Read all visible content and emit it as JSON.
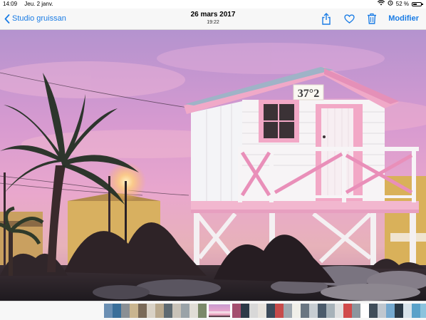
{
  "status_bar": {
    "time": "14:09",
    "date": "Jeu. 2 janv.",
    "battery_percent": "52 %",
    "battery_level": 0.52
  },
  "nav": {
    "back_label": "Studio gruissan",
    "title_date": "26 mars 2017",
    "title_time": "19:22",
    "edit_label": "Modifier",
    "accent_color": "#1a7ce5"
  },
  "photo": {
    "sign_text": "37°2",
    "description_icons": [
      "share-icon",
      "heart-icon",
      "trash-icon"
    ]
  },
  "thumbnails": {
    "active_index": 12,
    "colors": [
      "#6b8fb3",
      "#3a6f9a",
      "#8a8f94",
      "#c9b58f",
      "#7a6a58",
      "#d9d2c6",
      "#b9a98e",
      "#5e6a72",
      "#c8c2b8",
      "#9aa3a8",
      "#e0ddd6",
      "#7b8a6a",
      "#c48ab8",
      "#a44f6f",
      "#2d3a48",
      "#d8d8d8",
      "#e7e3dd",
      "#3b4a5a",
      "#c74b4b",
      "#9fa8b0",
      "#f0efe9",
      "#6a7682",
      "#c7cdd2",
      "#4b5b6b",
      "#a7b2b9",
      "#e0e0e0",
      "#d14a4a",
      "#8c969e",
      "#ffffff",
      "#3f4d5a",
      "#bfc7cf",
      "#74a9cf",
      "#2a3946",
      "#d8e3ea",
      "#5aa2c9",
      "#8cc3dd",
      "#c2d7e3",
      "#4f89b1"
    ]
  }
}
